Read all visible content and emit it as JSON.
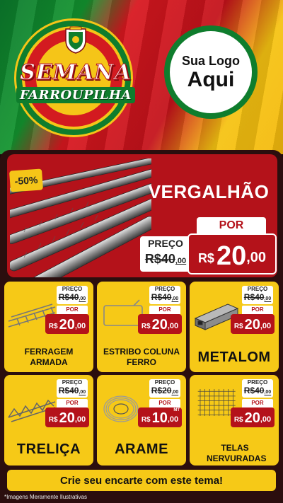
{
  "header": {
    "event_title_line1": "SEMANA",
    "event_title_line2": "FARROUPILHA",
    "logo_placeholder_line1": "Sua Logo",
    "logo_placeholder_line2": "Aqui"
  },
  "featured": {
    "badge": "-50%",
    "title": "VERGALHÃO",
    "old_label": "PREÇO",
    "old_price_int": "R$40",
    "old_price_dec": ",00",
    "new_label": "POR",
    "currency": "R$",
    "price_int": "20",
    "price_dec": ",00"
  },
  "products": [
    {
      "name": "FERRAGEM ARMADA",
      "old_label": "PREÇO",
      "old_price_int": "R$40",
      "old_price_dec": ",00",
      "new_label": "POR",
      "currency": "R$",
      "price_int": "20",
      "price_dec": ",00",
      "unit": "",
      "icon": "rebar-cage-icon"
    },
    {
      "name": "ESTRIBO COLUNA FERRO",
      "old_label": "PREÇO",
      "old_price_int": "R$40",
      "old_price_dec": ",00",
      "new_label": "POR",
      "currency": "R$",
      "price_int": "20",
      "price_dec": ",00",
      "unit": "",
      "icon": "stirrup-icon"
    },
    {
      "name": "METALOM",
      "old_label": "PREÇO",
      "old_price_int": "R$40",
      "old_price_dec": ",00",
      "new_label": "POR",
      "currency": "R$",
      "price_int": "20",
      "price_dec": ",00",
      "unit": "",
      "icon": "metal-tube-icon"
    },
    {
      "name": "TRELIÇA",
      "old_label": "PREÇO",
      "old_price_int": "R$40",
      "old_price_dec": ",00",
      "new_label": "POR",
      "currency": "R$",
      "price_int": "20",
      "price_dec": ",00",
      "unit": "",
      "icon": "truss-icon"
    },
    {
      "name": "ARAME",
      "old_label": "PREÇO",
      "old_price_int": "R$20",
      "old_price_dec": ",00",
      "new_label": "POR",
      "currency": "R$",
      "price_int": "10",
      "price_dec": ",00",
      "unit": "MT",
      "icon": "wire-coil-icon"
    },
    {
      "name": "TELAS NERVURADAS",
      "old_label": "PREÇO",
      "old_price_int": "R$40",
      "old_price_dec": ",00",
      "new_label": "POR",
      "currency": "R$",
      "price_int": "20",
      "price_dec": ",00",
      "unit": "",
      "icon": "mesh-icon"
    }
  ],
  "footer": {
    "cta": "Crie seu encarte com este tema!",
    "disclaimer": "*Imagens Meramente Ilustrativas"
  },
  "colors": {
    "flag_green": "#0f7d2d",
    "flag_red": "#d31a20",
    "flag_yellow": "#f5c518",
    "card_yellow": "#f6c917",
    "price_red": "#b4121a"
  }
}
